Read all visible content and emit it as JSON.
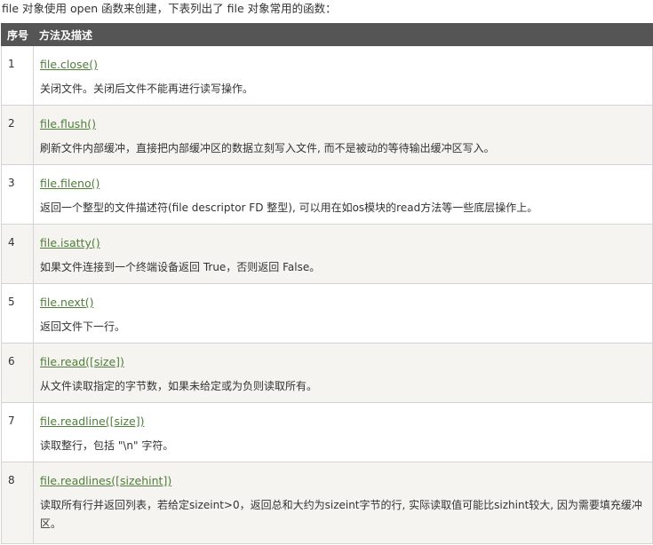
{
  "intro": "file 对象使用 open 函数来创建，下表列出了 file 对象常用的函数：",
  "table": {
    "headers": [
      "序号",
      "方法及描述"
    ],
    "rows": [
      {
        "num": "1",
        "method": "file.close()",
        "desc": "关闭文件。关闭后文件不能再进行读写操作。"
      },
      {
        "num": "2",
        "method": "file.flush()",
        "desc": "刷新文件内部缓冲，直接把内部缓冲区的数据立刻写入文件, 而不是被动的等待输出缓冲区写入。"
      },
      {
        "num": "3",
        "method": "file.fileno()",
        "desc": "返回一个整型的文件描述符(file descriptor FD 整型), 可以用在如os模块的read方法等一些底层操作上。"
      },
      {
        "num": "4",
        "method": "file.isatty()",
        "desc": "如果文件连接到一个终端设备返回 True，否则返回 False。"
      },
      {
        "num": "5",
        "method": "file.next()",
        "desc": "返回文件下一行。"
      },
      {
        "num": "6",
        "method": "file.read([size])",
        "desc": "从文件读取指定的字节数，如果未给定或为负则读取所有。"
      },
      {
        "num": "7",
        "method": "file.readline([size])",
        "desc": "读取整行，包括 \"\\n\" 字符。"
      },
      {
        "num": "8",
        "method": "file.readlines([sizehint])",
        "desc": "读取所有行并返回列表，若给定sizeint>0，返回总和大约为sizeint字节的行, 实际读取值可能比sizhint较大, 因为需要填充缓冲区。"
      }
    ]
  }
}
